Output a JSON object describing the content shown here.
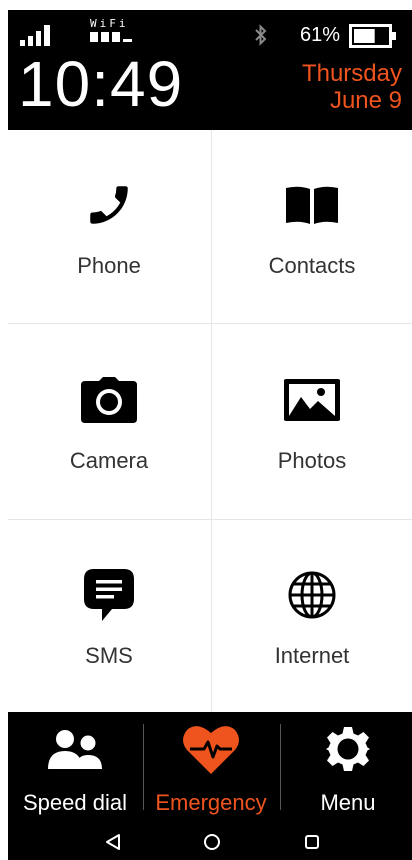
{
  "status_bar": {
    "wifi_label": "WiFi",
    "battery_percent": "61%",
    "battery_level": 0.61,
    "time": "10:49",
    "day": "Thursday",
    "date": "June 9",
    "accent_color": "#f0541e"
  },
  "apps": [
    {
      "label": "Phone",
      "icon": "phone-icon"
    },
    {
      "label": "Contacts",
      "icon": "book-icon"
    },
    {
      "label": "Camera",
      "icon": "camera-icon"
    },
    {
      "label": "Photos",
      "icon": "photos-icon"
    },
    {
      "label": "SMS",
      "icon": "message-icon"
    },
    {
      "label": "Internet",
      "icon": "globe-icon"
    }
  ],
  "bottom_bar": {
    "speed_dial": "Speed dial",
    "emergency": "Emergency",
    "menu": "Menu"
  },
  "nav_bar": [
    "back-icon",
    "home-icon",
    "recents-icon"
  ]
}
